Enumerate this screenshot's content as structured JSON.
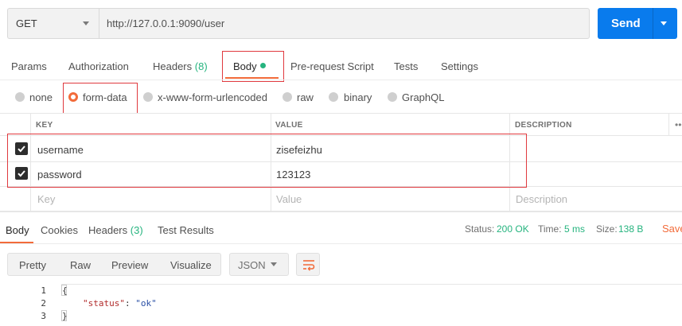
{
  "request": {
    "method": "GET",
    "url": "http://127.0.0.1:9090/user",
    "send_label": "Send"
  },
  "request_tabs": {
    "params": "Params",
    "authorization": "Authorization",
    "headers": "Headers",
    "headers_count": "(8)",
    "body": "Body",
    "pre_request_script": "Pre-request Script",
    "tests": "Tests",
    "settings": "Settings"
  },
  "body_types": {
    "none": "none",
    "form_data": "form-data",
    "urlencoded": "x-www-form-urlencoded",
    "raw": "raw",
    "binary": "binary",
    "graphql": "GraphQL",
    "selected": "form-data"
  },
  "params_table": {
    "headers": {
      "key": "KEY",
      "value": "VALUE",
      "description": "DESCRIPTION"
    },
    "rows": [
      {
        "checked": true,
        "key": "username",
        "value": "zisefeizhu",
        "description": ""
      },
      {
        "checked": true,
        "key": "password",
        "value": "123123",
        "description": ""
      }
    ],
    "placeholder": {
      "key": "Key",
      "value": "Value",
      "description": "Description"
    }
  },
  "response_tabs": {
    "body": "Body",
    "cookies": "Cookies",
    "headers": "Headers",
    "headers_count": "(3)",
    "test_results": "Test Results"
  },
  "response_meta": {
    "status_label": "Status:",
    "status_value": "200 OK",
    "time_label": "Time:",
    "time_value": "5 ms",
    "size_label": "Size:",
    "size_value": "138 B",
    "save_label": "Save"
  },
  "view_options": {
    "pretty": "Pretty",
    "raw": "Raw",
    "preview": "Preview",
    "visualize": "Visualize",
    "format": "JSON"
  },
  "code": {
    "line_numbers": [
      "1",
      "2",
      "3"
    ],
    "open_brace": "{",
    "key": "\"status\"",
    "colon": ": ",
    "value": "\"ok\"",
    "close_brace": "}"
  },
  "colors": {
    "accent": "#f26b3a",
    "send_button": "#097bed",
    "success": "#26b47f",
    "highlight_box": "#e0393e"
  }
}
